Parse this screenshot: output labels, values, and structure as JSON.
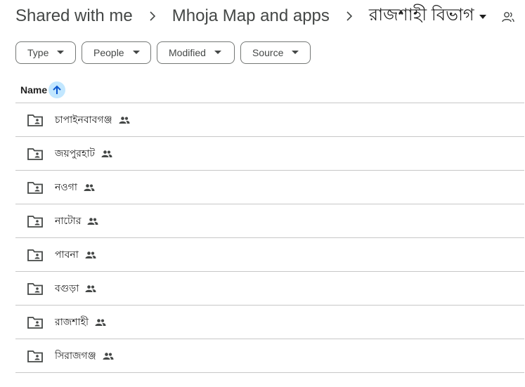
{
  "breadcrumb": {
    "root": "Shared with me",
    "parent": "Mhoja Map and apps",
    "current": "রাজশাহী বিভাগ",
    "separator": "›"
  },
  "filters": [
    {
      "label": "Type"
    },
    {
      "label": "People"
    },
    {
      "label": "Modified"
    },
    {
      "label": "Source"
    }
  ],
  "table": {
    "name_header": "Name",
    "sort": "ascending"
  },
  "rows": [
    {
      "name": "চাপাইনবাবগঞ্জ"
    },
    {
      "name": "জয়পুরহাট"
    },
    {
      "name": "নওগা"
    },
    {
      "name": "নাটোর"
    },
    {
      "name": "পাবনা"
    },
    {
      "name": "বগুড়া"
    },
    {
      "name": "রাজশাহী"
    },
    {
      "name": "সিরাজগঞ্জ"
    }
  ],
  "colors": {
    "text": "#1f1f1f",
    "secondary_text": "#444746",
    "sort_highlight": "#c2e7ff",
    "sort_arrow": "#0b57d0",
    "divider": "#c7c7c7"
  },
  "icons": {
    "separator": "chevron-right-icon",
    "dropdown": "arrow-drop-down-icon",
    "folder": "shared-folder-icon",
    "shared": "people-icon",
    "sort": "arrow-upward-icon",
    "top_right": "person-outline-icon"
  }
}
